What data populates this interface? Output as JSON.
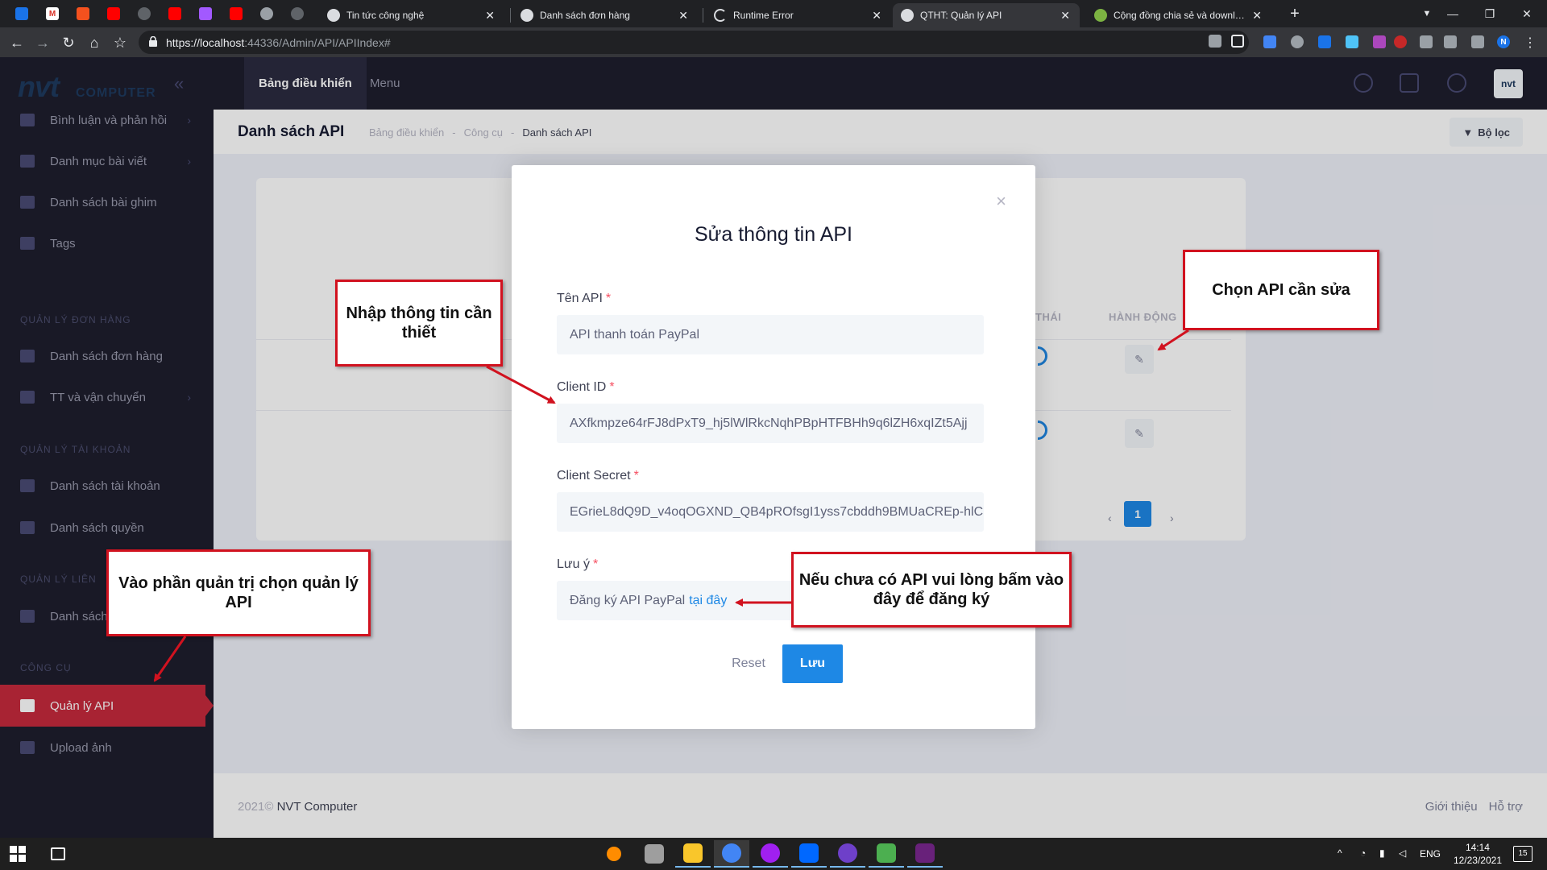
{
  "browser": {
    "tabs": [
      {
        "title": "Tin tức công nghệ",
        "active": false
      },
      {
        "title": "Danh sách đơn hàng",
        "active": false
      },
      {
        "title": "Runtime Error",
        "active": false
      },
      {
        "title": "QTHT: Quản lý API",
        "active": true
      },
      {
        "title": "Cộng đồng chia sẻ và download",
        "active": false
      }
    ],
    "url_host": "https://localhost",
    "url_path": ":44336/Admin/API/APIIndex#",
    "profile_initial": "N"
  },
  "brand": {
    "main": "nvt",
    "sub": "COMPUTER"
  },
  "sidebar": {
    "items": [
      {
        "label": "Bình luận và phản hồi"
      },
      {
        "label": "Danh mục bài viết"
      },
      {
        "label": "Danh sách bài ghim"
      },
      {
        "label": "Tags"
      },
      {
        "label": "Danh sách đơn hàng"
      },
      {
        "label": "TT và vận chuyển"
      },
      {
        "label": "Danh sách tài khoản"
      },
      {
        "label": "Danh sách quyền"
      },
      {
        "label": "Danh sách"
      },
      {
        "label": "Quản lý API"
      },
      {
        "label": "Upload ảnh"
      }
    ],
    "sections": [
      "Quản lý đơn hàng",
      "Quản lý tài khoản",
      "Quản lý liên",
      "Công cụ"
    ]
  },
  "header": {
    "tabs": [
      "Bảng điều khiển",
      "Menu"
    ],
    "avatar": "nvt"
  },
  "subheader": {
    "title": "Danh sách API",
    "breadcrumb": [
      "Bảng điều khiển",
      "-",
      "Công cụ",
      "-",
      "Danh sách API"
    ],
    "filter_label": "Bộ lọc"
  },
  "table": {
    "col_status": "THÁI",
    "col_actions": "HÀNH ĐỘNG",
    "page": "1",
    "prev": "‹",
    "next": "›"
  },
  "footer": {
    "year": "2021©",
    "company": "NVT Computer",
    "links": [
      "Giới thiệu",
      "Hỗ trợ"
    ]
  },
  "modal": {
    "title": "Sửa thông tin API",
    "fields": [
      {
        "label": "Tên API",
        "value": "API thanh toán PayPal"
      },
      {
        "label": "Client ID",
        "value": "AXfkmpze64rFJ8dPxT9_hj5lWlRkcNqhPBpHTFBHh9q6lZH6xqIZt5Ajj"
      },
      {
        "label": "Client Secret",
        "value": "EGrieL8dQ9D_v4oqOGXND_QB4pROfsgI1yss7cbddh9BMUaCREp-hlC"
      },
      {
        "label": "Lưu ý",
        "value": "Đăng ký API PayPal",
        "link": "tại đây"
      }
    ],
    "required_mark": "*",
    "reset_label": "Reset",
    "save_label": "Lưu",
    "close_glyph": "×"
  },
  "callouts": {
    "choose_api": "Chọn API cần sửa",
    "enter_info": "Nhập thông tin cần thiết",
    "admin_api": "Vào phần quản trị chọn quản lý API",
    "register": "Nếu chưa có API vui lòng bấm vào đây để đăng ký"
  },
  "taskbar": {
    "lang": "ENG",
    "time": "14:14",
    "date": "12/23/2021",
    "notif_count": "15"
  },
  "colors": {
    "accent": "#1e88e5",
    "active_menu": "#c62a3c",
    "callout_border": "#d1121f"
  }
}
